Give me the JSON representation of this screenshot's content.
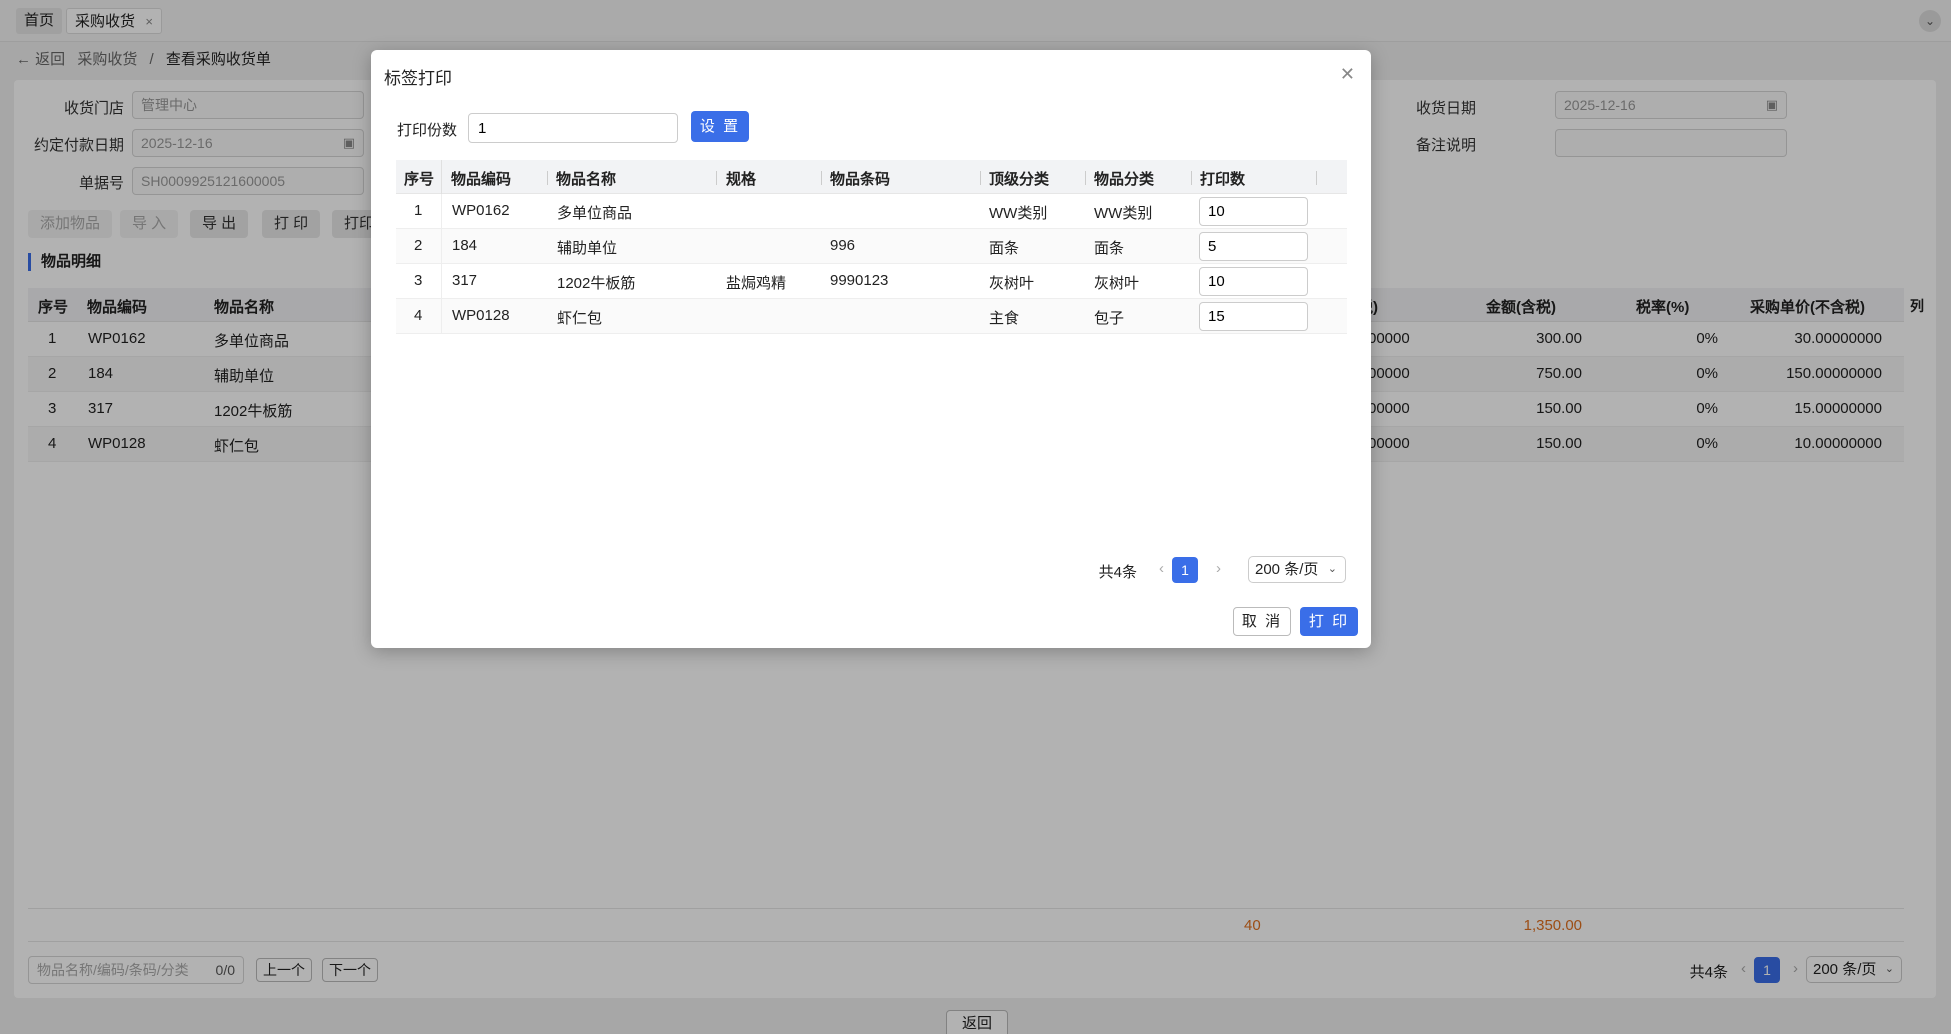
{
  "tabs": {
    "home": "首页",
    "active": "采购收货",
    "close": "×"
  },
  "breadcrumb": {
    "back": "← 返回",
    "parent": "采购收货",
    "sep": "/",
    "current": "查看采购收货单"
  },
  "form": {
    "store_label": "收货门店",
    "store_value": "管理中心",
    "due_label": "约定付款日期",
    "due_value": "2025-12-16",
    "no_label": "单据号",
    "no_value": "SH0009925121600005",
    "recv_date_label": "收货日期",
    "recv_date_value": "2025-12-16",
    "remark_label": "备注说明",
    "remark_value": ""
  },
  "toolbar": {
    "add": "添加物品",
    "import": "导 入",
    "export": "导 出",
    "print": "打 印",
    "print2": "打印"
  },
  "section": "物品明细",
  "bg_table": {
    "headers": {
      "seq": "序号",
      "code": "物品编码",
      "name": "物品名称",
      "tax_price": "税)",
      "amount": "金额(含税)",
      "rate": "税率(%)",
      "unit_price": "采购单价(不含税)",
      "cols": "列"
    },
    "rows": [
      {
        "seq": "1",
        "code": "WP0162",
        "name": "多单位商品",
        "a": "00000",
        "amount": "300.00",
        "rate": "0%",
        "unit": "30.00000000"
      },
      {
        "seq": "2",
        "code": "184",
        "name": "辅助单位",
        "a": "00000",
        "amount": "750.00",
        "rate": "0%",
        "unit": "150.00000000"
      },
      {
        "seq": "3",
        "code": "317",
        "name": "1202牛板筋",
        "a": "00000",
        "amount": "150.00",
        "rate": "0%",
        "unit": "15.00000000"
      },
      {
        "seq": "4",
        "code": "WP0128",
        "name": "虾仁包",
        "a": "00000",
        "amount": "150.00",
        "rate": "0%",
        "unit": "10.00000000"
      }
    ],
    "totals": {
      "qty": "40",
      "amount": "1,350.00"
    }
  },
  "bottom": {
    "search_placeholder": "物品名称/编码/条码/分类",
    "count": "0/0",
    "prev": "上一个",
    "next": "下一个",
    "total": "共4条",
    "page": "1",
    "page_size": "200 条/页"
  },
  "return_button": "返回",
  "modal": {
    "title": "标签打印",
    "copies_label": "打印份数",
    "copies_value": "1",
    "set_button": "设 置",
    "headers": [
      "序号",
      "物品编码",
      "物品名称",
      "规格",
      "物品条码",
      "顶级分类",
      "物品分类",
      "打印数"
    ],
    "rows": [
      {
        "seq": "1",
        "code": "WP0162",
        "name": "多单位商品",
        "spec": "",
        "barcode": "",
        "top_cat": "WW类别",
        "cat": "WW类别",
        "count": "10"
      },
      {
        "seq": "2",
        "code": "184",
        "name": "辅助单位",
        "spec": "",
        "barcode": "996",
        "top_cat": "面条",
        "cat": "面条",
        "count": "5"
      },
      {
        "seq": "3",
        "code": "317",
        "name": "1202牛板筋",
        "spec": "盐焗鸡精",
        "barcode": "9990123",
        "top_cat": "灰树叶",
        "cat": "灰树叶",
        "count": "10"
      },
      {
        "seq": "4",
        "code": "WP0128",
        "name": "虾仁包",
        "spec": "",
        "barcode": "",
        "top_cat": "主食",
        "cat": "包子",
        "count": "15"
      }
    ],
    "pager": {
      "total": "共4条",
      "page": "1",
      "page_size": "200 条/页"
    },
    "cancel": "取 消",
    "print": "打 印"
  }
}
